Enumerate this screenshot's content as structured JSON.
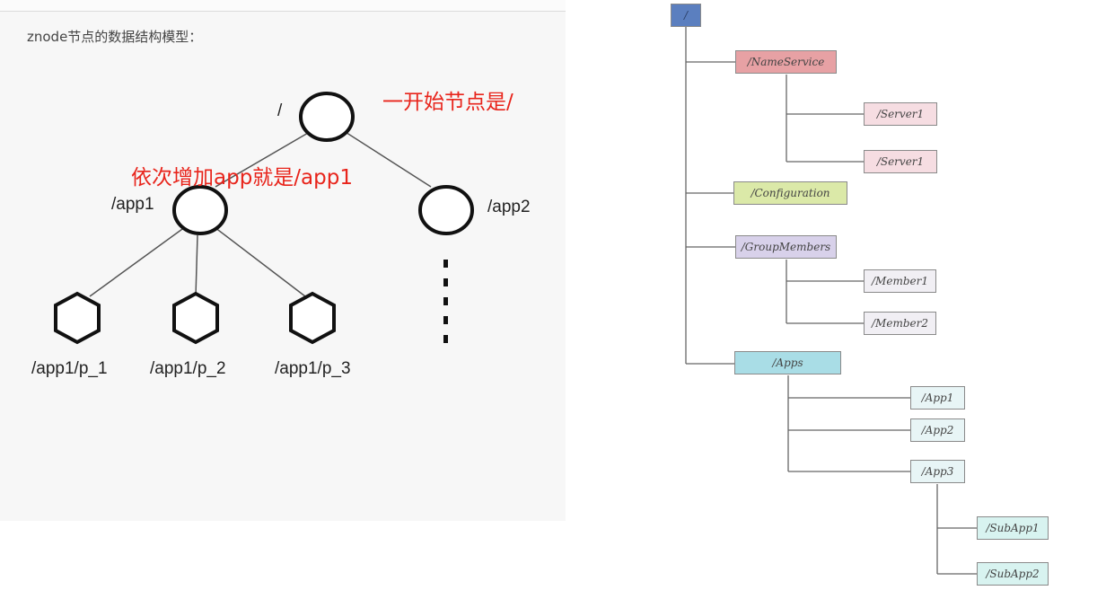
{
  "znode_model": {
    "heading": "znode节点的数据结构模型：",
    "root_label": "/",
    "app1_label": "/app1",
    "app2_label": "/app2",
    "leaves": [
      "/app1/p_1",
      "/app1/p_2",
      "/app1/p_3"
    ],
    "annotation_root": "一开始节点是/",
    "annotation_app": "依次增加app就是/app1"
  },
  "namespace_tree": {
    "root": "/",
    "name_service": "/NameService",
    "server_a": "/Server1",
    "server_b": "/Server1",
    "configuration": "/Configuration",
    "group_members": "/GroupMembers",
    "member1": "/Member1",
    "member2": "/Member2",
    "apps": "/Apps",
    "app1": "/App1",
    "app2": "/App2",
    "app3": "/App3",
    "subapp1": "/SubApp1",
    "subapp2": "/SubApp2"
  },
  "colors": {
    "root": "#5b7fbf",
    "name_service": "#e7a1a4",
    "server": "#f6dde2",
    "configuration": "#dbe9a8",
    "group_members": "#d8d1ea",
    "member": "#f1eff4",
    "apps": "#a9dde6",
    "app": "#e8f5f6",
    "subapp": "#d8f3f0",
    "annotation": "#e8241b"
  }
}
